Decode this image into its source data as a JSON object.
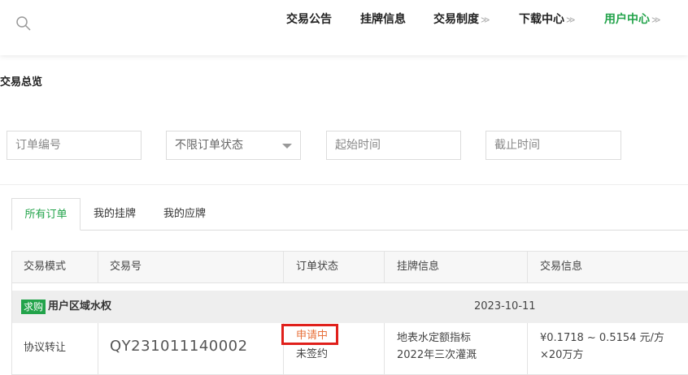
{
  "header": {
    "nav": [
      {
        "label": "交易公告",
        "has_dropdown": false,
        "active": false
      },
      {
        "label": "挂牌信息",
        "has_dropdown": false,
        "active": false
      },
      {
        "label": "交易制度",
        "has_dropdown": true,
        "active": false
      },
      {
        "label": "下载中心",
        "has_dropdown": true,
        "active": false
      },
      {
        "label": "用户中心",
        "has_dropdown": true,
        "active": true
      }
    ],
    "accent_color": "#22a34a"
  },
  "section_title": "交易总览",
  "filters": {
    "order_no_placeholder": "订单编号",
    "status_select_value": "不限订单状态",
    "start_time_placeholder": "起始时间",
    "end_time_placeholder": "截止时间"
  },
  "tabs": [
    {
      "label": "所有订单",
      "active": true
    },
    {
      "label": "我的挂牌",
      "active": false
    },
    {
      "label": "我的应牌",
      "active": false
    }
  ],
  "table": {
    "columns": [
      "交易模式",
      "交易号",
      "订单状态",
      "挂牌信息",
      "交易信息"
    ],
    "groups": [
      {
        "badge": "求购",
        "name": "用户区域水权",
        "date": "2023-10-11",
        "rows": [
          {
            "mode": "协议转让",
            "order_no": "QY231011140002",
            "status_primary": "申请中",
            "status_secondary": "未签约",
            "listing_line1": "地表水定额指标",
            "listing_line2": "2022年三次灌溉",
            "trade_line1": "¥0.1718 ~ 0.5154 元/方",
            "trade_line2": "×20万方"
          }
        ]
      }
    ]
  }
}
